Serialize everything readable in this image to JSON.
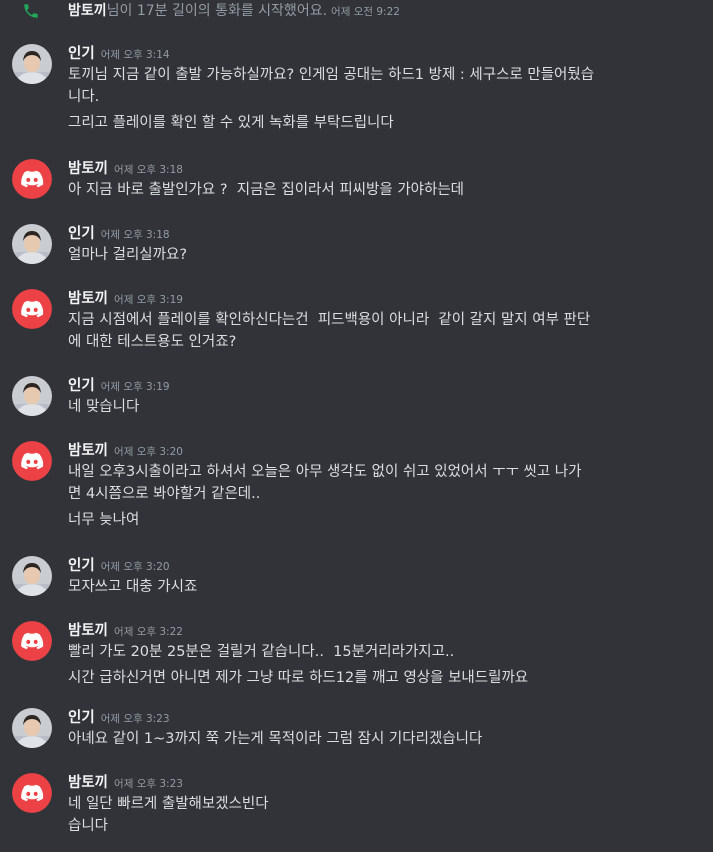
{
  "call": {
    "user": "밤토끼",
    "text": "님이 17분 길이의 통화를 시작했어요.",
    "timestamp": "어제 오전 9:22",
    "icon": "phone-icon",
    "icon_color": "#23a55a"
  },
  "colors": {
    "discord_red": "#ed4245",
    "background": "#313338"
  },
  "messages": [
    {
      "user": "인기",
      "avatar": "user-photo-avatar",
      "timestamp": "어제 오후 3:14",
      "lines": [
        "토끼님 지금 같이 출발 가능하실까요? 인게임 공대는 하드1 방제 : 세구스로 만들어뒀습",
        "니다.",
        "그리고 플레이를 확인 할 수 있게 녹화를 부탁드립니다"
      ]
    },
    {
      "user": "밤토끼",
      "avatar": "discord-default-avatar",
      "timestamp": "어제 오후 3:18",
      "lines": [
        "아 지금 바로 출발인가요 ?  지금은 집이라서 피씨방을 가야하는데"
      ]
    },
    {
      "user": "인기",
      "avatar": "user-photo-avatar",
      "timestamp": "어제 오후 3:18",
      "lines": [
        "얼마나 걸리실까요?"
      ]
    },
    {
      "user": "밤토끼",
      "avatar": "discord-default-avatar",
      "timestamp": "어제 오후 3:19",
      "lines": [
        "지금 시점에서 플레이를 확인하신다는건  피드백용이 아니라  같이 갈지 말지 여부 판단",
        "에 대한 테스트용도 인거죠?"
      ]
    },
    {
      "user": "인기",
      "avatar": "user-photo-avatar",
      "timestamp": "어제 오후 3:19",
      "lines": [
        "네 맞습니다"
      ]
    },
    {
      "user": "밤토끼",
      "avatar": "discord-default-avatar",
      "timestamp": "어제 오후 3:20",
      "lines": [
        "내일 오후3시출이라고 하셔서 오늘은 아무 생각도 없이 쉬고 있었어서 ㅜㅜ 씻고 나가",
        "면 4시쯤으로 봐야할거 같은데..",
        "너무 늦나여"
      ]
    },
    {
      "user": "인기",
      "avatar": "user-photo-avatar",
      "timestamp": "어제 오후 3:20",
      "lines": [
        "모자쓰고 대충 가시죠"
      ]
    },
    {
      "user": "밤토끼",
      "avatar": "discord-default-avatar",
      "timestamp": "어제 오후 3:22",
      "lines": [
        "빨리 가도 20분 25분은 걸릴거 같습니다..  15분거리라가지고..",
        "시간 급하신거면 아니면 제가 그냥 따로 하드12를 깨고 영상을 보내드릴까요"
      ]
    },
    {
      "user": "인기",
      "avatar": "user-photo-avatar",
      "timestamp": "어제 오후 3:23",
      "lines": [
        "아녜요 같이 1~3까지 쭉 가는게 목적이라 그럼 잠시 기다리겠습니다"
      ]
    },
    {
      "user": "밤토끼",
      "avatar": "discord-default-avatar",
      "timestamp": "어제 오후 3:23",
      "lines": [
        "네 일단 빠르게 출발해보겠스빈다",
        "습니다"
      ]
    }
  ]
}
